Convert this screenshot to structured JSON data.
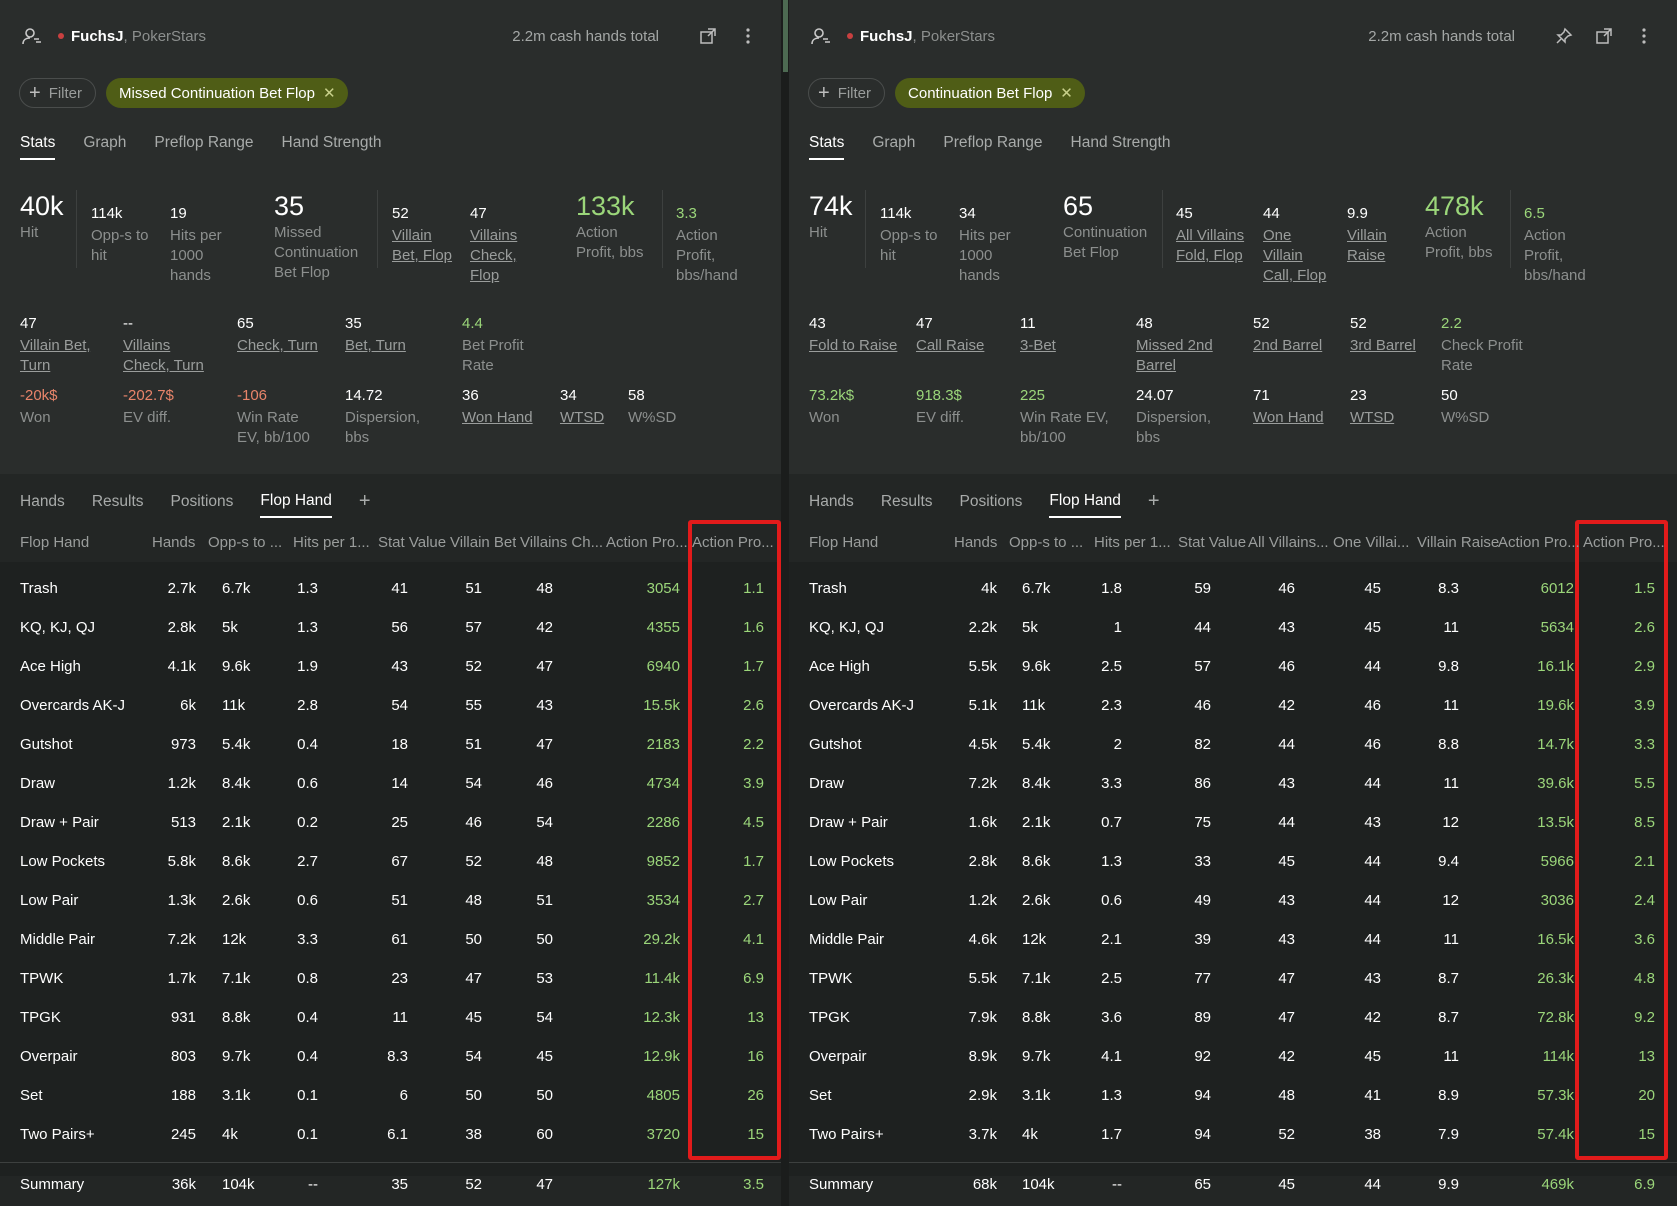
{
  "left": {
    "player": "FuchsJ",
    "room": ", PokerStars",
    "total": "2.2m cash hands total",
    "filter_label": "Filter",
    "chip_label": "Missed Continuation Bet Flop",
    "tabs": [
      "Stats",
      "Graph",
      "Preflop Range",
      "Hand Strength"
    ],
    "stats_row1": [
      {
        "v": "40k",
        "l": "Hit"
      },
      {
        "v": "114k",
        "l": "Opp-s to hit"
      },
      {
        "v": "19",
        "l": "Hits per 1000 hands"
      },
      {
        "v": "35",
        "l": "Missed Continuation Bet Flop"
      },
      {
        "v": "52",
        "l": "Villain Bet, Flop"
      },
      {
        "v": "47",
        "l": "Villains Check, Flop"
      },
      {
        "v": "133k",
        "l": "Action Profit, bbs"
      },
      {
        "v": "3.3",
        "l": "Action Profit, bbs/hand"
      }
    ],
    "stats_row2": [
      {
        "v": "47",
        "l": "Villain Bet, Turn"
      },
      {
        "v": "--",
        "l": "Villains Check, Turn"
      },
      {
        "v": "65",
        "l": "Check, Turn"
      },
      {
        "v": "35",
        "l": "Bet, Turn"
      },
      {
        "v": "4.4",
        "l": "Bet Profit Rate"
      }
    ],
    "stats_row3": [
      {
        "v": "-20k$",
        "l": "Won"
      },
      {
        "v": "-202.7$",
        "l": "EV diff."
      },
      {
        "v": "-106",
        "l": "Win Rate EV, bb/100"
      },
      {
        "v": "14.72",
        "l": "Dispersion, bbs"
      },
      {
        "v": "36",
        "l": "Won Hand"
      },
      {
        "v": "34",
        "l": "WTSD"
      },
      {
        "v": "58",
        "l": "W%SD"
      }
    ],
    "bottom_tabs": [
      "Hands",
      "Results",
      "Positions",
      "Flop Hand"
    ],
    "columns": [
      "Flop Hand",
      "Hands",
      "Opp-s to ...",
      "Hits per 1...",
      "Stat Value",
      "Villain Bet",
      "Villains Ch...",
      "Action Pro...",
      "Action Pro..."
    ],
    "rows": [
      [
        "Trash",
        "2.7k",
        "6.7k",
        "1.3",
        "41",
        "51",
        "48",
        "3054",
        "1.1"
      ],
      [
        "KQ, KJ, QJ",
        "2.8k",
        "5k",
        "1.3",
        "56",
        "57",
        "42",
        "4355",
        "1.6"
      ],
      [
        "Ace High",
        "4.1k",
        "9.6k",
        "1.9",
        "43",
        "52",
        "47",
        "6940",
        "1.7"
      ],
      [
        "Overcards AK-J",
        "6k",
        "11k",
        "2.8",
        "54",
        "55",
        "43",
        "15.5k",
        "2.6"
      ],
      [
        "Gutshot",
        "973",
        "5.4k",
        "0.4",
        "18",
        "51",
        "47",
        "2183",
        "2.2"
      ],
      [
        "Draw",
        "1.2k",
        "8.4k",
        "0.6",
        "14",
        "54",
        "46",
        "4734",
        "3.9"
      ],
      [
        "Draw + Pair",
        "513",
        "2.1k",
        "0.2",
        "25",
        "46",
        "54",
        "2286",
        "4.5"
      ],
      [
        "Low Pockets",
        "5.8k",
        "8.6k",
        "2.7",
        "67",
        "52",
        "48",
        "9852",
        "1.7"
      ],
      [
        "Low Pair",
        "1.3k",
        "2.6k",
        "0.6",
        "51",
        "48",
        "51",
        "3534",
        "2.7"
      ],
      [
        "Middle Pair",
        "7.2k",
        "12k",
        "3.3",
        "61",
        "50",
        "50",
        "29.2k",
        "4.1"
      ],
      [
        "TPWK",
        "1.7k",
        "7.1k",
        "0.8",
        "23",
        "47",
        "53",
        "11.4k",
        "6.9"
      ],
      [
        "TPGK",
        "931",
        "8.8k",
        "0.4",
        "11",
        "45",
        "54",
        "12.3k",
        "13"
      ],
      [
        "Overpair",
        "803",
        "9.7k",
        "0.4",
        "8.3",
        "54",
        "45",
        "12.9k",
        "16"
      ],
      [
        "Set",
        "188",
        "3.1k",
        "0.1",
        "6",
        "50",
        "50",
        "4805",
        "26"
      ],
      [
        "Two Pairs+",
        "245",
        "4k",
        "0.1",
        "6.1",
        "38",
        "60",
        "3720",
        "15"
      ]
    ],
    "summary": [
      "Summary",
      "36k",
      "104k",
      "--",
      "35",
      "52",
      "47",
      "127k",
      "3.5"
    ]
  },
  "right": {
    "player": "FuchsJ",
    "room": ", PokerStars",
    "total": "2.2m cash hands total",
    "filter_label": "Filter",
    "chip_label": "Continuation Bet Flop",
    "tabs": [
      "Stats",
      "Graph",
      "Preflop Range",
      "Hand Strength"
    ],
    "stats_row1": [
      {
        "v": "74k",
        "l": "Hit"
      },
      {
        "v": "114k",
        "l": "Opp-s to hit"
      },
      {
        "v": "34",
        "l": "Hits per 1000 hands"
      },
      {
        "v": "65",
        "l": "Continuation Bet Flop"
      },
      {
        "v": "45",
        "l": "All Villains Fold, Flop"
      },
      {
        "v": "44",
        "l": "One Villain Call, Flop"
      },
      {
        "v": "9.9",
        "l": "Villain Raise"
      },
      {
        "v": "478k",
        "l": "Action Profit, bbs"
      },
      {
        "v": "6.5",
        "l": "Action Profit, bbs/hand"
      }
    ],
    "stats_row2": [
      {
        "v": "43",
        "l": "Fold to Raise"
      },
      {
        "v": "47",
        "l": "Call Raise"
      },
      {
        "v": "11",
        "l": "3-Bet"
      },
      {
        "v": "48",
        "l": "Missed 2nd Barrel"
      },
      {
        "v": "52",
        "l": "2nd Barrel"
      },
      {
        "v": "52",
        "l": "3rd Barrel"
      },
      {
        "v": "2.2",
        "l": "Check Profit Rate"
      }
    ],
    "stats_row3": [
      {
        "v": "73.2k$",
        "l": "Won"
      },
      {
        "v": "918.3$",
        "l": "EV diff."
      },
      {
        "v": "225",
        "l": "Win Rate EV, bb/100"
      },
      {
        "v": "24.07",
        "l": "Dispersion, bbs"
      },
      {
        "v": "71",
        "l": "Won Hand"
      },
      {
        "v": "23",
        "l": "WTSD"
      },
      {
        "v": "50",
        "l": "W%SD"
      }
    ],
    "bottom_tabs": [
      "Hands",
      "Results",
      "Positions",
      "Flop Hand"
    ],
    "columns": [
      "Flop Hand",
      "Hands",
      "Opp-s to ...",
      "Hits per 1...",
      "Stat Value",
      "All Villains...",
      "One Villai...",
      "Villain Raise",
      "Action Pro...",
      "Action Pro..."
    ],
    "rows": [
      [
        "Trash",
        "4k",
        "6.7k",
        "1.8",
        "59",
        "46",
        "45",
        "8.3",
        "6012",
        "1.5"
      ],
      [
        "KQ, KJ, QJ",
        "2.2k",
        "5k",
        "1",
        "44",
        "43",
        "45",
        "11",
        "5634",
        "2.6"
      ],
      [
        "Ace High",
        "5.5k",
        "9.6k",
        "2.5",
        "57",
        "46",
        "44",
        "9.8",
        "16.1k",
        "2.9"
      ],
      [
        "Overcards AK-J",
        "5.1k",
        "11k",
        "2.3",
        "46",
        "42",
        "46",
        "11",
        "19.6k",
        "3.9"
      ],
      [
        "Gutshot",
        "4.5k",
        "5.4k",
        "2",
        "82",
        "44",
        "46",
        "8.8",
        "14.7k",
        "3.3"
      ],
      [
        "Draw",
        "7.2k",
        "8.4k",
        "3.3",
        "86",
        "43",
        "44",
        "11",
        "39.6k",
        "5.5"
      ],
      [
        "Draw + Pair",
        "1.6k",
        "2.1k",
        "0.7",
        "75",
        "44",
        "43",
        "12",
        "13.5k",
        "8.5"
      ],
      [
        "Low Pockets",
        "2.8k",
        "8.6k",
        "1.3",
        "33",
        "45",
        "44",
        "9.4",
        "5966",
        "2.1"
      ],
      [
        "Low Pair",
        "1.2k",
        "2.6k",
        "0.6",
        "49",
        "43",
        "44",
        "12",
        "3036",
        "2.4"
      ],
      [
        "Middle Pair",
        "4.6k",
        "12k",
        "2.1",
        "39",
        "43",
        "44",
        "11",
        "16.5k",
        "3.6"
      ],
      [
        "TPWK",
        "5.5k",
        "7.1k",
        "2.5",
        "77",
        "47",
        "43",
        "8.7",
        "26.3k",
        "4.8"
      ],
      [
        "TPGK",
        "7.9k",
        "8.8k",
        "3.6",
        "89",
        "47",
        "42",
        "8.7",
        "72.8k",
        "9.2"
      ],
      [
        "Overpair",
        "8.9k",
        "9.7k",
        "4.1",
        "92",
        "42",
        "45",
        "11",
        "114k",
        "13"
      ],
      [
        "Set",
        "2.9k",
        "3.1k",
        "1.3",
        "94",
        "48",
        "41",
        "8.9",
        "57.3k",
        "20"
      ],
      [
        "Two Pairs+",
        "3.7k",
        "4k",
        "1.7",
        "94",
        "52",
        "38",
        "7.9",
        "57.4k",
        "15"
      ]
    ],
    "summary": [
      "Summary",
      "68k",
      "104k",
      "--",
      "65",
      "45",
      "44",
      "9.9",
      "469k",
      "6.9"
    ]
  },
  "colors": {
    "accent_green": "#9bd67a",
    "negative": "#e8846a",
    "chip_bg": "#4f5d16",
    "highlight": "#e21b1b"
  },
  "icons": [
    "user-settings-icon",
    "popout-icon",
    "more-vert-icon",
    "pin-icon",
    "plus-icon",
    "close-icon"
  ]
}
